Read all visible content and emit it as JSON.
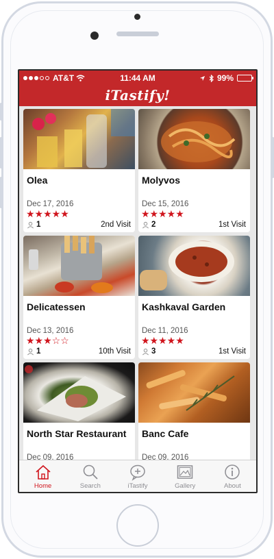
{
  "status_bar": {
    "carrier": "AT&T",
    "time": "11:44 AM",
    "battery": "99%",
    "battery_level": 0.99
  },
  "header": {
    "logo": "iTastify!"
  },
  "restaurants": [
    {
      "name": "Olea",
      "date": "Dec 17, 2016",
      "stars": "★★★★★",
      "rating": 5,
      "guests": "1",
      "visit": "2nd Visit"
    },
    {
      "name": "Molyvos",
      "date": "Dec 15, 2016",
      "stars": "★★★★★",
      "rating": 5,
      "guests": "2",
      "visit": "1st Visit"
    },
    {
      "name": "Delicatessen",
      "date": "Dec 13, 2016",
      "stars": "★★★☆☆",
      "rating": 3,
      "guests": "1",
      "visit": "10th Visit"
    },
    {
      "name": "Kashkaval Garden",
      "date": "Dec 11, 2016",
      "stars": "★★★★★",
      "rating": 5,
      "guests": "3",
      "visit": "1st Visit"
    },
    {
      "name": "North Star Restaurant",
      "date": "Dec 09, 2016"
    },
    {
      "name": "Banc Cafe",
      "date": "Dec 09, 2016"
    }
  ],
  "tabs": [
    {
      "label": "Home",
      "icon": "home-icon",
      "active": true
    },
    {
      "label": "Search",
      "icon": "search-icon"
    },
    {
      "label": "iTastify",
      "icon": "add-comment-icon"
    },
    {
      "label": "Gallery",
      "icon": "gallery-icon"
    },
    {
      "label": "About",
      "icon": "info-icon"
    }
  ],
  "colors": {
    "brand": "#c3282a",
    "star": "#d0151d",
    "tab_active": "#d0151d",
    "tab_inactive": "#8e8e93"
  }
}
